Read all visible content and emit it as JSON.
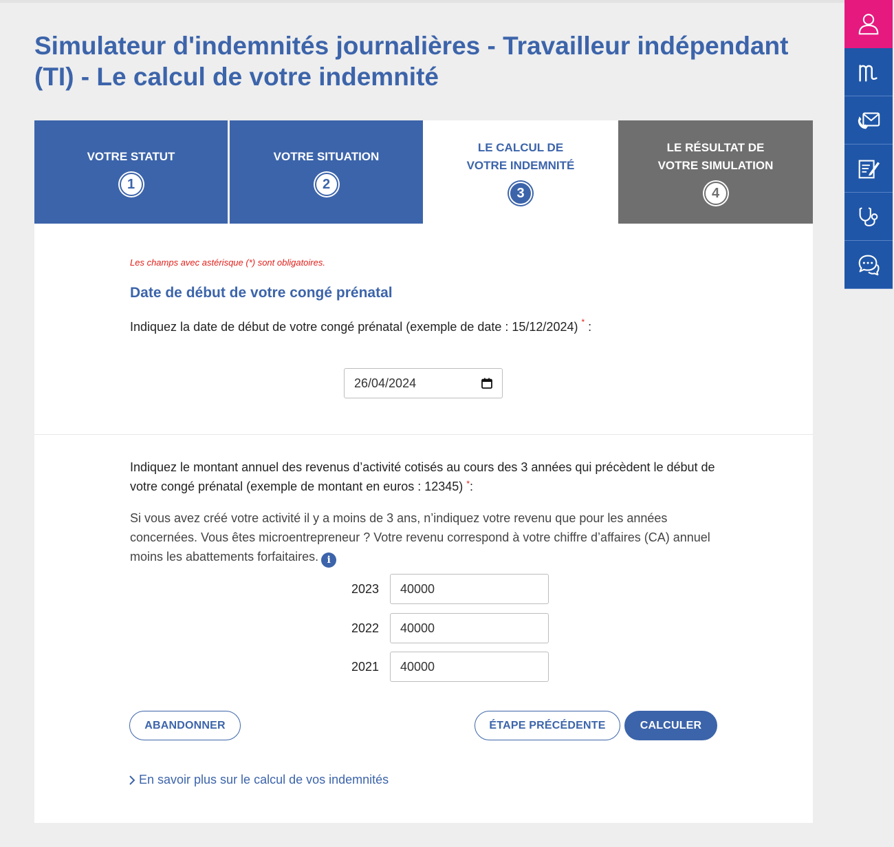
{
  "page": {
    "title": "Simulateur d'indemnités journalières - Travailleur indépendant (TI) - Le calcul de votre indemnité"
  },
  "steps": [
    {
      "label_line1": "VOTRE STATUT",
      "label_line2": "",
      "number": "1"
    },
    {
      "label_line1": "VOTRE SITUATION",
      "label_line2": "",
      "number": "2"
    },
    {
      "label_line1": "LE CALCUL DE",
      "label_line2": "VOTRE INDEMNITÉ",
      "number": "3"
    },
    {
      "label_line1": "LE RÉSULTAT DE",
      "label_line2": "VOTRE SIMULATION",
      "number": "4"
    }
  ],
  "form": {
    "required_note": "Les champs avec astérisque (*) sont obligatoires.",
    "section_title": "Date de début de votre congé prénatal",
    "date_label": "Indiquez la date de début de votre congé prénatal (exemple de date : 15/12/2024)",
    "date_value": "26/04/2024",
    "asterisk": "*",
    "colon": " :",
    "colon_tight": ":",
    "income_label": "Indiquez le montant annuel des revenus d’activité cotisés au cours des 3 années qui précèdent le début de votre congé prénatal (exemple de montant en euros : 12345)",
    "income_help": "Si vous avez créé votre activité il y a moins de 3 ans, n’indiquez votre revenu que pour les années concernées. Vous êtes microentrepreneur ? Votre revenu correspond à votre chiffre d’affaires (CA) annuel moins les abattements forfaitaires.",
    "info_glyph": "i",
    "years": [
      {
        "year": "2023",
        "value": "40000"
      },
      {
        "year": "2022",
        "value": "40000"
      },
      {
        "year": "2021",
        "value": "40000"
      }
    ]
  },
  "buttons": {
    "abandon": "ABANDONNER",
    "previous": "ÉTAPE PRÉCÉDENTE",
    "calculate": "CALCULER"
  },
  "links": {
    "more": "En savoir plus sur le calcul de vos indemnités"
  },
  "toolbar": {
    "icons": [
      "user-icon",
      "ameli-logo-icon",
      "phone-mail-icon",
      "edit-form-icon",
      "stethoscope-icon",
      "chat-icon"
    ]
  },
  "colors": {
    "brand_blue": "#3c64aa",
    "toolbar_blue": "#1f56a8",
    "accent_pink": "#e6197f",
    "step_inactive_gray": "#6f6f6f",
    "required_red": "#e0201b"
  }
}
